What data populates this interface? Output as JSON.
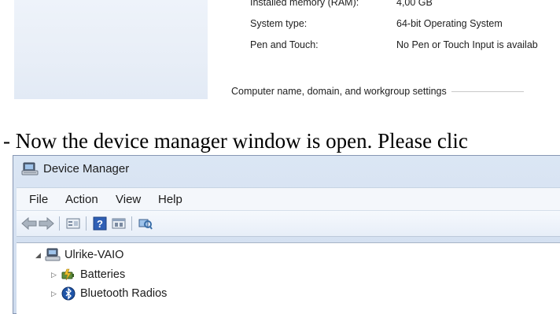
{
  "system_info": {
    "rows": [
      {
        "label": "Installed memory (RAM):",
        "value": "4,00 GB"
      },
      {
        "label": "System type:",
        "value": "64-bit Operating System"
      },
      {
        "label": "Pen and Touch:",
        "value": "No Pen or Touch Input is availab"
      }
    ],
    "section_heading": "Computer name, domain, and workgroup settings"
  },
  "instruction": "- Now the device manager window is open. Please clic",
  "device_manager": {
    "title": "Device Manager",
    "menu": [
      "File",
      "Action",
      "View",
      "Help"
    ],
    "toolbar_icons": [
      "back-arrow-icon",
      "forward-arrow-icon",
      "properties-icon",
      "help-icon",
      "view-icon",
      "scan-hardware-icon"
    ],
    "tree": {
      "root": "Ulrike-VAIO",
      "children": [
        "Batteries",
        "Bluetooth Radios"
      ]
    }
  }
}
